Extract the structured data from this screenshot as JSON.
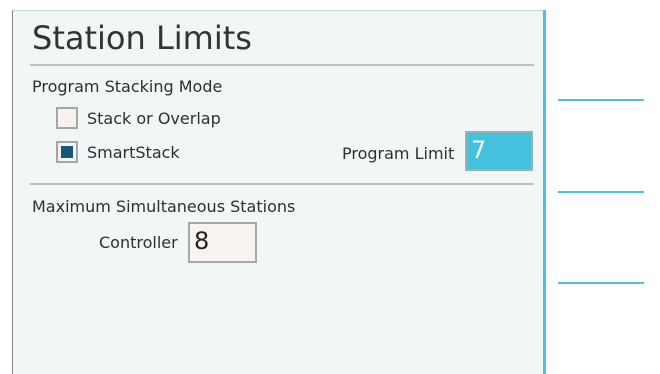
{
  "screen": {
    "title": "Station Limits"
  },
  "program_stacking": {
    "label": "Program Stacking Mode",
    "options": [
      {
        "label": "Stack or Overlap",
        "checked": false
      },
      {
        "label": "SmartStack",
        "checked": true
      }
    ],
    "program_limit": {
      "label": "Program Limit",
      "value": "7"
    }
  },
  "max_simultaneous": {
    "label": "Maximum Simultaneous Stations",
    "controller": {
      "label": "Controller",
      "value": "8"
    }
  },
  "colors": {
    "accent": "#45c3df",
    "field_selected": "#44c1dc",
    "checkbox_fill": "#145a78"
  }
}
